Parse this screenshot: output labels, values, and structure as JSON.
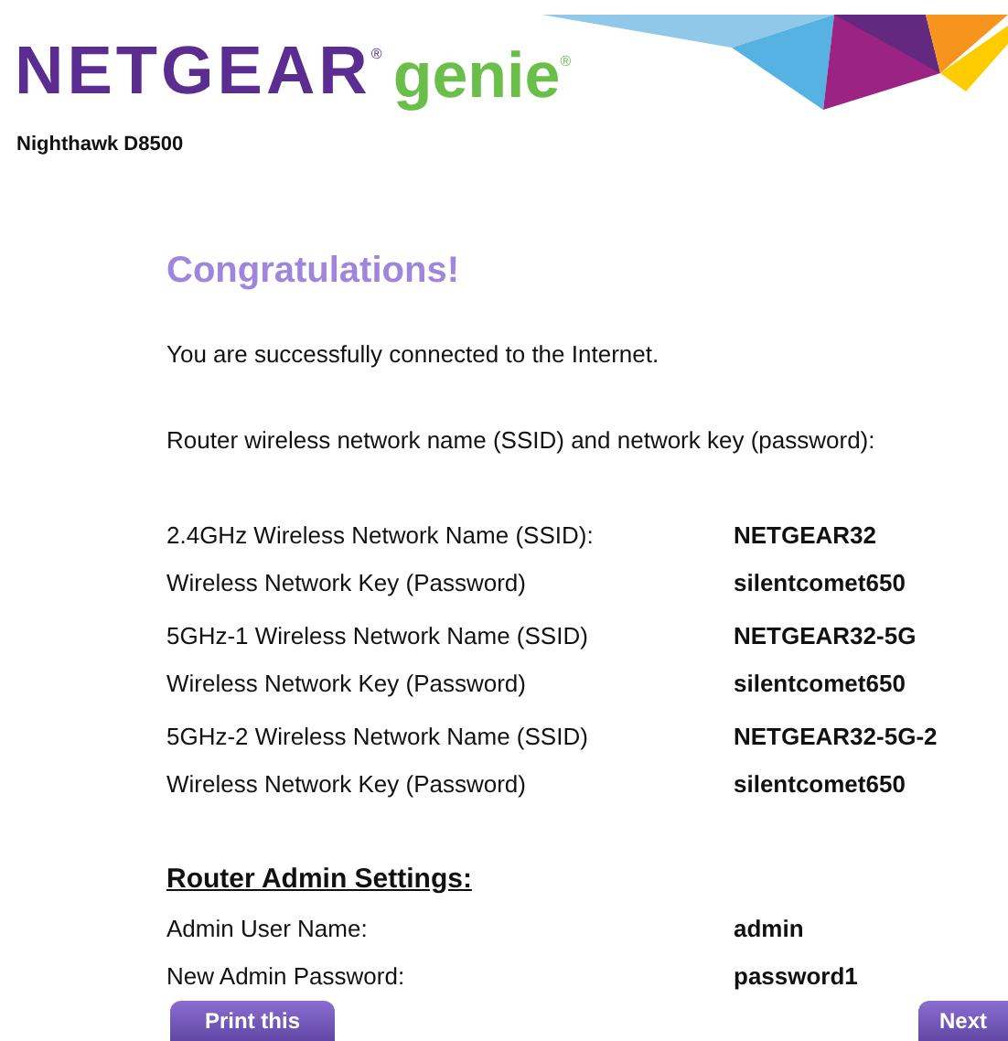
{
  "header": {
    "brand": "NETGEAR",
    "brand_mark": "®",
    "product": "genie",
    "product_mark": "®",
    "model": "Nighthawk D8500"
  },
  "title": "Congratulations!",
  "message": "You are successfully connected to the Internet.",
  "intro": "Router wireless network name (SSID) and network key (password):",
  "wireless": [
    {
      "label": "2.4GHz Wireless Network Name (SSID):",
      "value": "NETGEAR32"
    },
    {
      "label": "Wireless Network Key (Password)",
      "value": "silentcomet650"
    },
    {
      "label": "5GHz-1 Wireless Network Name (SSID)",
      "value": "NETGEAR32-5G"
    },
    {
      "label": "Wireless Network Key (Password)",
      "value": "silentcomet650"
    },
    {
      "label": "5GHz-2 Wireless Network Name (SSID)",
      "value": "NETGEAR32-5G-2"
    },
    {
      "label": "Wireless Network Key (Password)",
      "value": "silentcomet650"
    }
  ],
  "admin": {
    "heading": "Router Admin Settings:",
    "rows": [
      {
        "label": "Admin User Name:",
        "value": "admin"
      },
      {
        "label": "New Admin Password:",
        "value": "password1"
      }
    ]
  },
  "buttons": [
    "Print this",
    "Next"
  ]
}
